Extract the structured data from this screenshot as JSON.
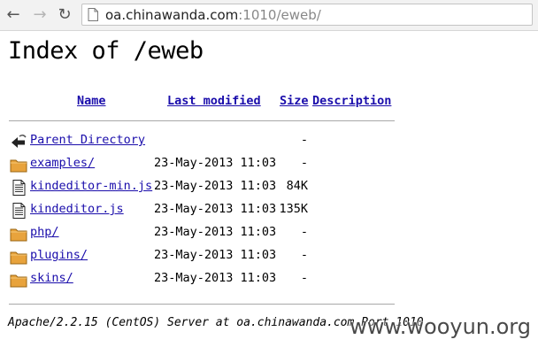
{
  "browser": {
    "url_host": "oa.chinawanda.com",
    "url_rest": ":1010/eweb/"
  },
  "page": {
    "title": "Index of /eweb",
    "columns": {
      "name": "Name",
      "last_modified": "Last modified",
      "size": "Size",
      "description": "Description"
    },
    "rows": [
      {
        "icon": "back-icon",
        "name": "Parent Directory",
        "date": "",
        "size": "-"
      },
      {
        "icon": "folder-icon",
        "name": "examples/",
        "date": "23-May-2013 11:03",
        "size": "-"
      },
      {
        "icon": "file-icon",
        "name": "kindeditor-min.js",
        "date": "23-May-2013 11:03",
        "size": "84K"
      },
      {
        "icon": "file-icon",
        "name": "kindeditor.js",
        "date": "23-May-2013 11:03",
        "size": "135K"
      },
      {
        "icon": "folder-icon",
        "name": "php/",
        "date": "23-May-2013 11:03",
        "size": "-"
      },
      {
        "icon": "folder-icon",
        "name": "plugins/",
        "date": "23-May-2013 11:03",
        "size": "-"
      },
      {
        "icon": "folder-icon",
        "name": "skins/",
        "date": "23-May-2013 11:03",
        "size": "-"
      }
    ],
    "server_signature": "Apache/2.2.15 (CentOS) Server at oa.chinawanda.com Port 1010"
  },
  "watermark": "www.wooyun.org",
  "colors": {
    "link": "#1a0dab",
    "folder": "#e8a33c"
  }
}
